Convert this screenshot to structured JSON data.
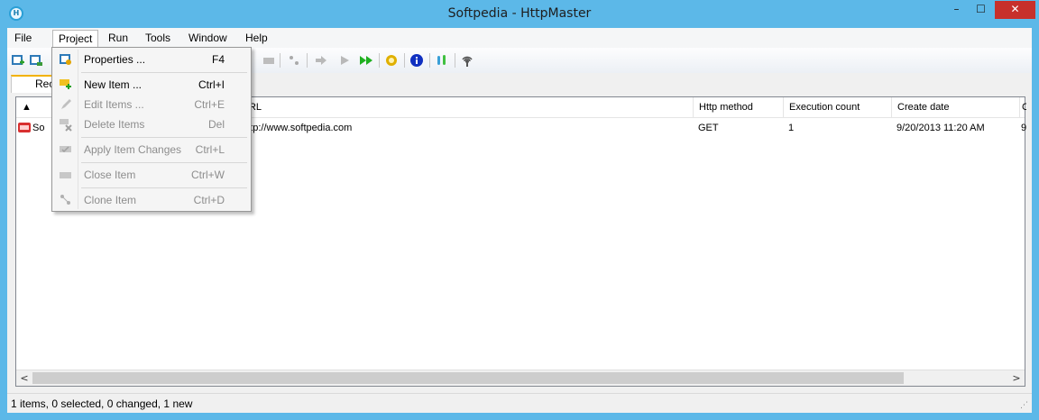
{
  "window": {
    "title": "Softpedia - HttpMaster",
    "min_glyph": "–",
    "max_glyph": "☐",
    "close_glyph": "✕"
  },
  "menubar": {
    "items": [
      "File",
      "Project",
      "Run",
      "Tools",
      "Window",
      "Help"
    ]
  },
  "tabs": {
    "active_partial": "Rec"
  },
  "table": {
    "columns": [
      "",
      "URL",
      "Http method",
      "Execution count",
      "Create date",
      "C"
    ],
    "rows": [
      {
        "name": "So",
        "url": "http://www.softpedia.com",
        "method": "GET",
        "count": "1",
        "created": "9/20/2013 11:20 AM",
        "extra": "9"
      }
    ],
    "sort_glyph": "▲"
  },
  "scrollbar": {
    "left": "<",
    "right": ">"
  },
  "statusbar": {
    "text": "1 items, 0 selected, 0 changed, 1 new"
  },
  "project_menu": {
    "items": [
      {
        "label": "Properties ...",
        "shortcut": "F4",
        "enabled": true,
        "icon": "properties-icon"
      },
      {
        "label": "New Item ...",
        "shortcut": "Ctrl+I",
        "enabled": true,
        "icon": "new-item-icon"
      },
      {
        "label": "Edit Items ...",
        "shortcut": "Ctrl+E",
        "enabled": false,
        "icon": "edit-items-icon"
      },
      {
        "label": "Delete Items",
        "shortcut": "Del",
        "enabled": false,
        "icon": "delete-items-icon"
      },
      {
        "label": "Apply Item Changes",
        "shortcut": "Ctrl+L",
        "enabled": false,
        "icon": "apply-changes-icon"
      },
      {
        "label": "Close Item",
        "shortcut": "Ctrl+W",
        "enabled": false,
        "icon": "close-item-icon"
      },
      {
        "label": "Clone Item",
        "shortcut": "Ctrl+D",
        "enabled": false,
        "icon": "clone-item-icon"
      }
    ]
  },
  "colors": {
    "title_bar": "#5cb8e8",
    "close_button": "#c7302b",
    "tab_accent": "#f2b200",
    "run_green": "#20b020",
    "info_blue": "#1030c0"
  }
}
